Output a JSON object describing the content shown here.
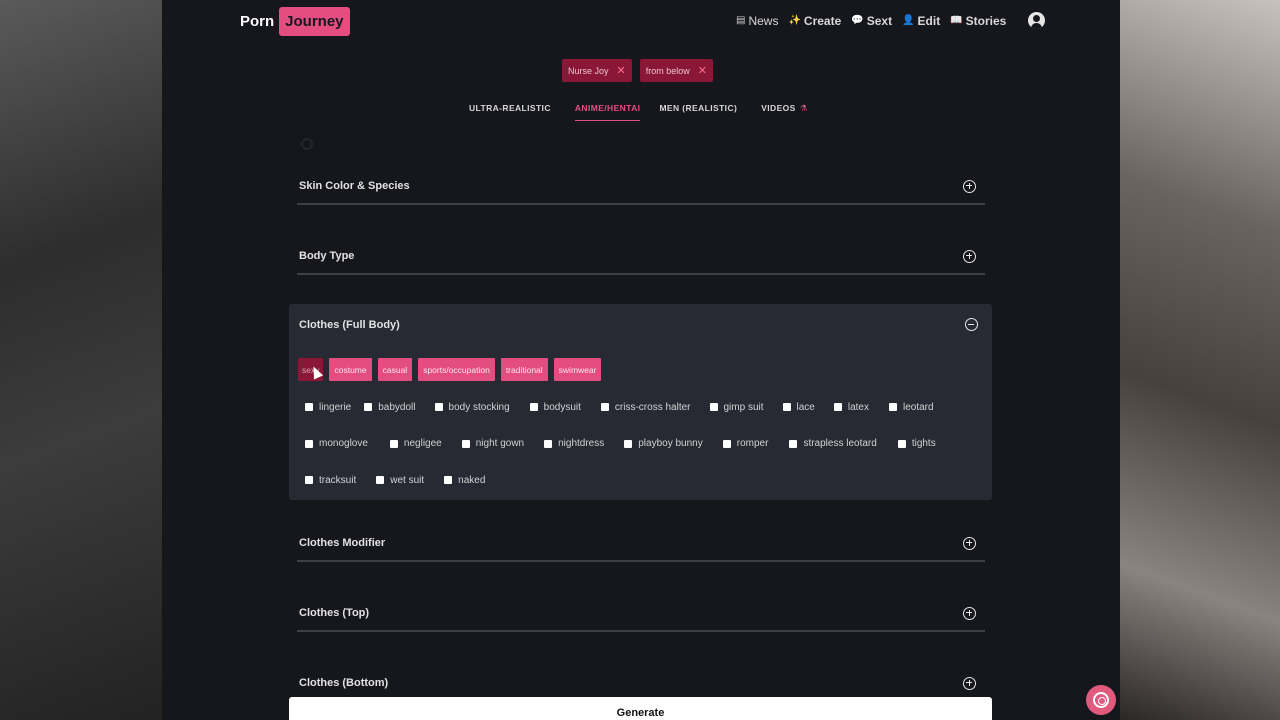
{
  "brand": {
    "part1": "Porn",
    "part2": "Journey"
  },
  "nav": [
    {
      "icon": "newspaper-icon",
      "glyph": "▤",
      "label": "News"
    },
    {
      "icon": "sparkle-icon",
      "glyph": "✨",
      "label": "Create"
    },
    {
      "icon": "chat-icon",
      "glyph": "💬",
      "label": "Sext"
    },
    {
      "icon": "person-icon",
      "glyph": "👤",
      "label": "Edit"
    },
    {
      "icon": "book-icon",
      "glyph": "📖",
      "label": "Stories"
    }
  ],
  "selected_tags": [
    "Nurse Joy",
    "from below"
  ],
  "tabs": {
    "t1": "ULTRA-REALISTIC",
    "t2": "ANIME/HENTAI",
    "t3": "MEN (REALISTIC)",
    "t4": "VIDEOS",
    "active": "ANIME/HENTAI"
  },
  "sections": {
    "skin": "Skin Color & Species",
    "body": "Body Type",
    "clothes_full": "Clothes (Full Body)",
    "clothes_mod": "Clothes Modifier",
    "clothes_top": "Clothes (Top)",
    "clothes_bottom": "Clothes (Bottom)"
  },
  "categories": [
    "sexy",
    "costume",
    "casual",
    "sports/occupation",
    "traditional",
    "swimwear"
  ],
  "active_category": "sexy",
  "options": {
    "row1": [
      "lingerie",
      "babydoll",
      "body stocking",
      "bodysuit",
      "criss-cross halter",
      "gimp suit",
      "lace",
      "latex",
      "leotard"
    ],
    "row2": [
      "monoglove",
      "negligee",
      "night gown",
      "nightdress",
      "playboy bunny",
      "romper",
      "strapless leotard",
      "tights"
    ],
    "row3": [
      "tracksuit",
      "wet suit",
      "naked"
    ]
  },
  "generate_label": "Generate",
  "colors": {
    "accent": "#e44d7f",
    "accent_dark": "#8b1736",
    "background": "#16171d",
    "panel": "#272a33"
  }
}
